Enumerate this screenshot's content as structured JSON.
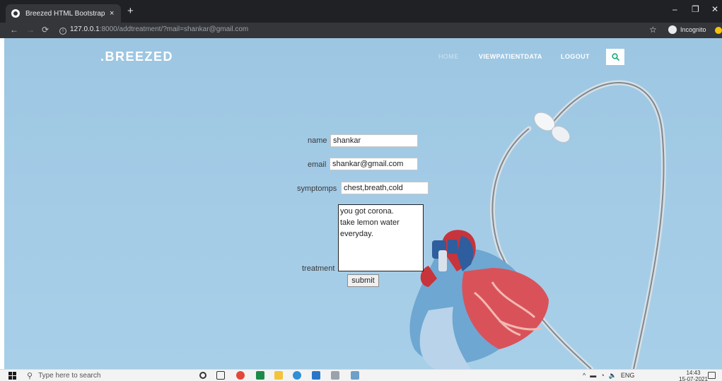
{
  "browser": {
    "tab_title": "Breezed HTML Bootstrap Templa",
    "tab_close": "×",
    "new_tab": "+",
    "url_host": "127.0.0.1",
    "url_path": ":8000/addtreatment/?mail=shankar@gmail.com",
    "incognito_label": "Incognito",
    "window_min": "–",
    "window_max": "❐",
    "window_close": "✕"
  },
  "site": {
    "brand": ".BREEZED",
    "nav": {
      "home": "HOME",
      "viewpatientdata": "VIEWPATIENTDATA",
      "logout": "LOGOUT"
    }
  },
  "form": {
    "name_label": "name",
    "name_value": "shankar",
    "email_label": "email",
    "email_value": "shankar@gmail.com",
    "symptoms_label": "symptomps",
    "symptoms_value": "chest,breath,cold",
    "treatment_label": "treatment",
    "treatment_value": "you got corona.\ntake lemon water\neveryday.",
    "submit_label": "submit"
  },
  "taskbar": {
    "search_placeholder": "Type here to search",
    "lang": "ENG",
    "time": "14:43",
    "date": "15-07-2021"
  },
  "colors": {
    "page_bg": "#a3cbe6",
    "chrome_dark": "#202124",
    "chrome_mid": "#35363a",
    "search_icon": "#19a97b"
  }
}
